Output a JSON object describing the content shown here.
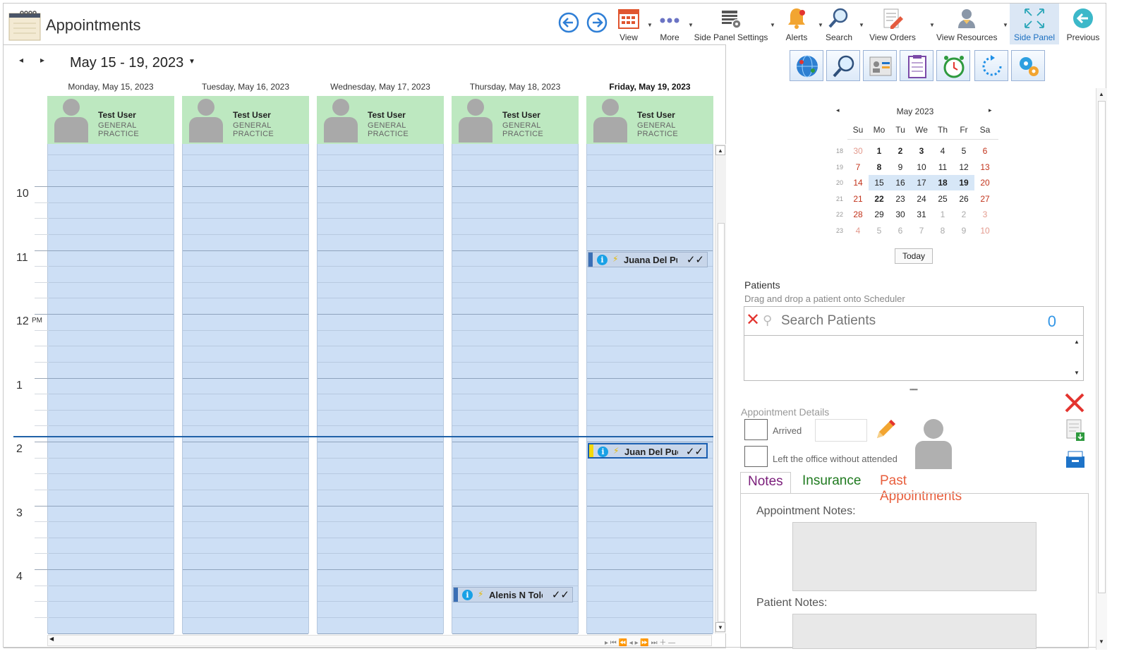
{
  "app": {
    "title": "Appointments"
  },
  "toolbar": {
    "items": [
      {
        "label": "View",
        "icon": "calendar-grid-icon"
      },
      {
        "label": "More",
        "icon": "more-dots-icon"
      },
      {
        "label": "Side Panel Settings",
        "icon": "table-settings-icon"
      },
      {
        "label": "Alerts",
        "icon": "bell-icon"
      },
      {
        "label": "Search",
        "icon": "magnifier-icon"
      },
      {
        "label": "View Orders",
        "icon": "orders-pencil-icon"
      },
      {
        "label": "View Resources",
        "icon": "resources-person-icon"
      },
      {
        "label": "Side Panel",
        "icon": "expand-arrows-icon"
      },
      {
        "label": "Previous",
        "icon": "back-arrow-circle-icon"
      }
    ]
  },
  "scheduler": {
    "range": "May 15 - 19, 2023",
    "days": [
      {
        "label": "Monday, May 15, 2023"
      },
      {
        "label": "Tuesday, May 16, 2023"
      },
      {
        "label": "Wednesday, May 17, 2023"
      },
      {
        "label": "Thursday, May 18, 2023"
      },
      {
        "label": "Friday, May 19, 2023"
      }
    ],
    "resource": {
      "name": "Test User",
      "dept": "GENERAL PRACTICE"
    },
    "hours": [
      "10",
      "11",
      "12",
      "1",
      "2",
      "3",
      "4"
    ],
    "pm_label": "PM",
    "appointments": [
      {
        "day": 4,
        "time": "11:00",
        "name": "Juana Del Puerto"
      },
      {
        "day": 4,
        "time": "14:00",
        "name": "Juan Del Puerto"
      },
      {
        "day": 3,
        "time": "16:15",
        "name": "Alenis N Toledo"
      }
    ],
    "current_time": "13:50"
  },
  "side_tools": [
    "globe-network-icon",
    "search-zoom-icon",
    "contact-card-icon",
    "clipboard-list-icon",
    "alarm-clock-icon",
    "refresh-cycle-icon",
    "gears-icon"
  ],
  "mini_calendar": {
    "month": "May 2023",
    "dow": [
      "Su",
      "Mo",
      "Tu",
      "We",
      "Th",
      "Fr",
      "Sa"
    ],
    "weeks": [
      {
        "wk": "18",
        "days": [
          "30",
          "1",
          "2",
          "3",
          "4",
          "5",
          "6"
        ]
      },
      {
        "wk": "19",
        "days": [
          "7",
          "8",
          "9",
          "10",
          "11",
          "12",
          "13"
        ]
      },
      {
        "wk": "20",
        "days": [
          "14",
          "15",
          "16",
          "17",
          "18",
          "19",
          "20"
        ]
      },
      {
        "wk": "21",
        "days": [
          "21",
          "22",
          "23",
          "24",
          "25",
          "26",
          "27"
        ]
      },
      {
        "wk": "22",
        "days": [
          "28",
          "29",
          "30",
          "31",
          "1",
          "2",
          "3"
        ]
      },
      {
        "wk": "23",
        "days": [
          "4",
          "5",
          "6",
          "7",
          "8",
          "9",
          "10"
        ]
      }
    ],
    "today_label": "Today"
  },
  "patients": {
    "title": "Patients",
    "subtitle": "Drag and drop a patient onto Scheduler",
    "search_placeholder": "Search Patients",
    "count": "0"
  },
  "appointment_details": {
    "title": "Appointment Details",
    "arrived_label": "Arrived",
    "left_label": "Left the office without attended"
  },
  "tabs": [
    "Notes",
    "Insurance",
    "Past Appointments"
  ],
  "notes": {
    "appointment_label": "Appointment Notes:",
    "patient_label": "Patient Notes:"
  },
  "colors": {
    "accent": "#1b6fc0",
    "resource_bg": "#bde8c0",
    "slot_bg": "#cddff5",
    "notes_tab": "#7a1d7a",
    "insurance_tab": "#1f7a1f",
    "past_tab": "#e85e3c"
  }
}
